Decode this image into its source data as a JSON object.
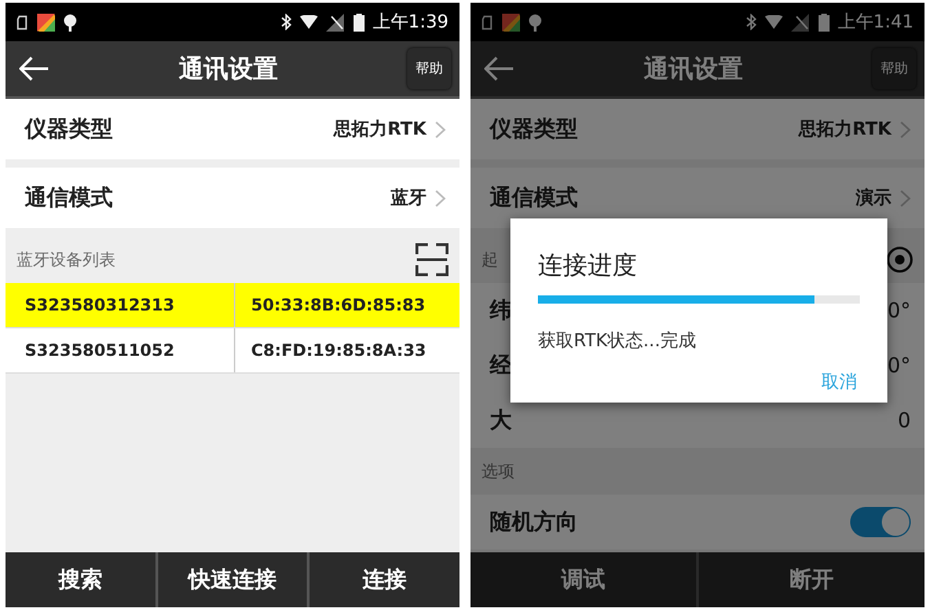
{
  "phones": [
    {
      "status_bar": {
        "time": "上午1:39"
      },
      "app_bar": {
        "title": "通讯设置",
        "help": "帮助"
      },
      "content": [
        {
          "kind": "setting",
          "label": "仪器类型",
          "value": "思拓力RTK"
        },
        {
          "kind": "setting",
          "label": "通信模式",
          "value": "蓝牙"
        },
        {
          "kind": "listheader",
          "label": "蓝牙设备列表"
        },
        {
          "kind": "device",
          "name": "S323580312313",
          "mac": "50:33:8B:6D:85:83",
          "selected": true
        },
        {
          "kind": "device",
          "name": "S323580511052",
          "mac": "C8:FD:19:85:8A:33",
          "selected": false
        }
      ],
      "bottom_buttons": [
        "搜索",
        "快速连接",
        "连接"
      ]
    },
    {
      "status_bar": {
        "time": "上午1:41"
      },
      "app_bar": {
        "title": "通讯设置",
        "help": "帮助"
      },
      "content": [
        {
          "kind": "setting",
          "label": "仪器类型",
          "value": "思拓力RTK"
        },
        {
          "kind": "setting",
          "label": "通信模式",
          "value": "演示"
        },
        {
          "kind": "groupheader",
          "label": "起"
        },
        {
          "kind": "param",
          "label": "纬",
          "value": "0°"
        },
        {
          "kind": "param",
          "label": "经",
          "value": "0°"
        },
        {
          "kind": "param",
          "label": "大",
          "value": "0"
        },
        {
          "kind": "section",
          "label": "选项"
        },
        {
          "kind": "toggle",
          "label": "随机方向",
          "on": true
        }
      ],
      "bottom_buttons": [
        "调试",
        "断开"
      ],
      "dialog": {
        "title": "连接进度",
        "level": 0.86,
        "message": "获取RTK状态...完成",
        "cancel": "取消"
      }
    }
  ]
}
